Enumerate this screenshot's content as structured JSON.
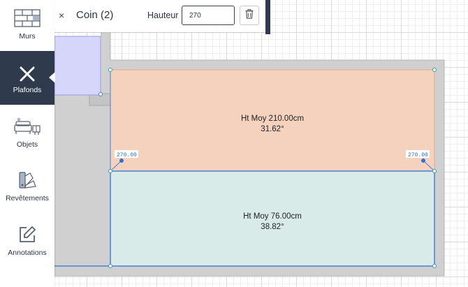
{
  "sidebar": {
    "items": [
      {
        "label": "Murs",
        "icon": "wall-bricks-icon"
      },
      {
        "label": "Plafonds",
        "icon": "close-x-icon",
        "active": true
      },
      {
        "label": "Objets",
        "icon": "furniture-icon"
      },
      {
        "label": "Revêtements",
        "icon": "paint-swatch-icon"
      },
      {
        "label": "Annotations",
        "icon": "edit-note-icon"
      }
    ]
  },
  "toolbar": {
    "close_symbol": "×",
    "title": "Coin (2)",
    "height_label": "Hauteur",
    "height_value": "270",
    "delete_icon": "trash-icon"
  },
  "plan": {
    "upper_panel": {
      "avg_height": "Ht Moy 210.00cm",
      "angle": "31.62°"
    },
    "lower_panel": {
      "avg_height": "Ht Moy 76.00cm",
      "angle": "38.82°"
    },
    "corner_left_value": "270.00",
    "corner_right_value": "270.00"
  },
  "colors": {
    "sidebar_active": "#2f3a4c",
    "upper_panel_fill": "#f5d2bd",
    "lower_panel_fill": "#d9ebe8",
    "selection_blue": "#4a7fd4",
    "room_wall": "#cfcfcf",
    "selected_room": "#d6d6fb"
  }
}
